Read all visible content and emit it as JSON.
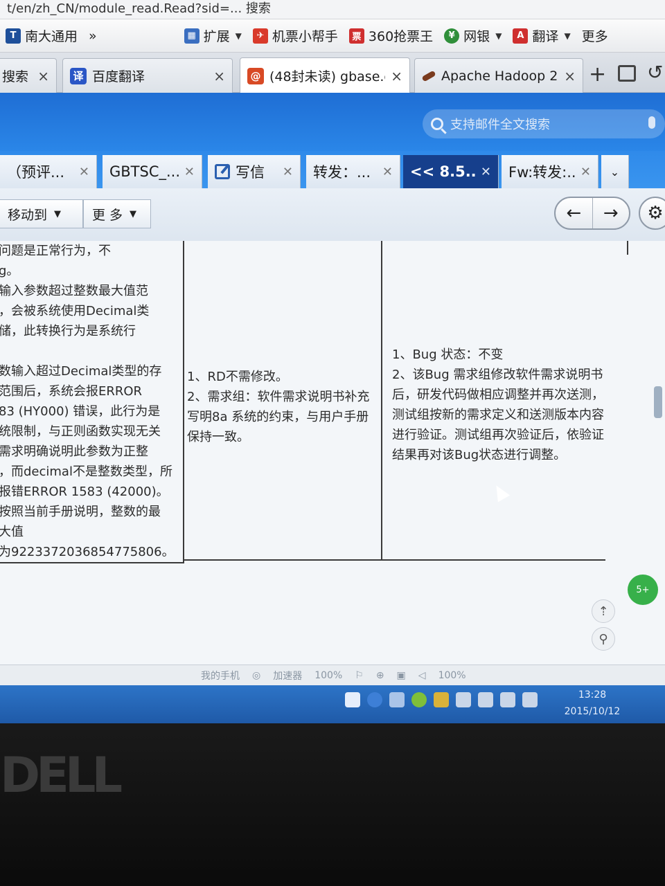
{
  "top_strip": "t/en/zh_CN/module_read.Read?sid=...   搜索",
  "bookmarks": [
    {
      "label": "南大通用",
      "icon": "site-icon",
      "color": "#1e4f9a"
    },
    {
      "label": "»",
      "icon": "",
      "color": ""
    },
    {
      "label": "扩展",
      "icon": "extensions-icon",
      "color": "#3a6ec0"
    },
    {
      "label": "机票小帮手",
      "icon": "plane-icon",
      "color": "#d93a2b"
    },
    {
      "label": "360抢票王",
      "icon": "ticket-icon",
      "color": "#cf2f2f"
    },
    {
      "label": "网银",
      "icon": "shield-icon",
      "color": "#2f8f3a"
    },
    {
      "label": "翻译",
      "icon": "translate-icon",
      "color": "#cf2f2f"
    },
    {
      "label": "更多",
      "icon": "",
      "color": ""
    }
  ],
  "browser_tabs": [
    {
      "label": "搜索",
      "icon": "",
      "color": ""
    },
    {
      "label": "百度翻译",
      "icon": "translate-icon",
      "color": "#2a56c6"
    },
    {
      "label": "(48封未读) gbase.c",
      "icon": "mail-at-icon",
      "color": "#d84a25"
    },
    {
      "label": "Apache Hadoop 2",
      "icon": "feather-icon",
      "color": "#7a3b1e"
    }
  ],
  "search": {
    "placeholder": "支持邮件全文搜索"
  },
  "mail_tabs": [
    {
      "label": "（预评...",
      "active": false
    },
    {
      "label": "GBTSC_...",
      "active": false
    },
    {
      "label": "写信",
      "active": false
    },
    {
      "label": "转发：...",
      "active": false
    },
    {
      "label": "<< 8.5...",
      "active": true
    },
    {
      "label": "Fw:转发:...",
      "active": false
    }
  ],
  "toolbar": {
    "move_to": "移动到",
    "more": "更 多",
    "prev": "←",
    "next": "→",
    "settings": "⚙"
  },
  "mail_table": {
    "col1_lines": [
      "问题是正常行为，不",
      "g。",
      "输入参数超过整数最大值范",
      "，会被系统使用Decimal类",
      "储，此转换行为是系统行",
      "",
      "数输入超过Decimal类型的存",
      "范围后，系统会报ERROR",
      "83 (HY000) 错误，此行为是",
      "统限制，与正则函数实现无关",
      "需求明确说明此参数为正整",
      "，而decimal不是整数类型，所",
      "报错ERROR 1583 (42000)。",
      "按照当前手册说明，整数的最",
      "大值",
      "为9223372036854775806。"
    ],
    "col2_lines": [
      "1、RD不需修改。",
      "2、需求组：软件需求说明书补充",
      "写明8a 系统的约束，与用户手册",
      "保持一致。"
    ],
    "col3_lines": [
      "1、Bug 状态：不变",
      "2、该Bug 需求组修改软件需求说明书",
      "后，研发代码做相应调整并再次送测，",
      "测试组按新的需求定义和送测版本内容",
      "进行验证。测试组再次验证后，依验证",
      "结果再对该Bug状态进行调整。"
    ]
  },
  "status_bar": [
    "我的手机",
    "加速器",
    "100%",
    "100%"
  ],
  "clock": {
    "time": "13:28",
    "date": "2015/10/12"
  },
  "bezel_logo": "DELL"
}
